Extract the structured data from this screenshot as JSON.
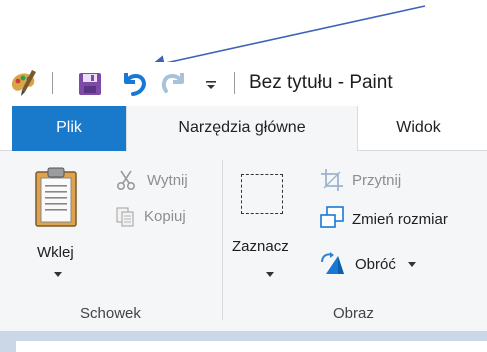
{
  "window": {
    "title": "Bez tytułu - Paint"
  },
  "quick_access": {
    "items": [
      {
        "name": "paint-app-icon"
      },
      {
        "name": "save-icon"
      },
      {
        "name": "undo-icon"
      },
      {
        "name": "redo-icon"
      },
      {
        "name": "customize-dropdown-icon"
      }
    ]
  },
  "tabs": {
    "file": "Plik",
    "home": "Narzędzia główne",
    "view": "Widok"
  },
  "clipboard": {
    "paste": "Wklej",
    "cut": "Wytnij",
    "copy": "Kopiuj",
    "group_label": "Schowek"
  },
  "image": {
    "select": "Zaznacz",
    "crop": "Przytnij",
    "resize": "Zmień rozmiar",
    "rotate": "Obróć",
    "group_label": "Obraz"
  },
  "colors": {
    "accent": "#1979ca",
    "ribbon_bg": "#f5f6f7",
    "canvas_bg": "#cbd6e6",
    "arrow": "#3d63b8"
  }
}
